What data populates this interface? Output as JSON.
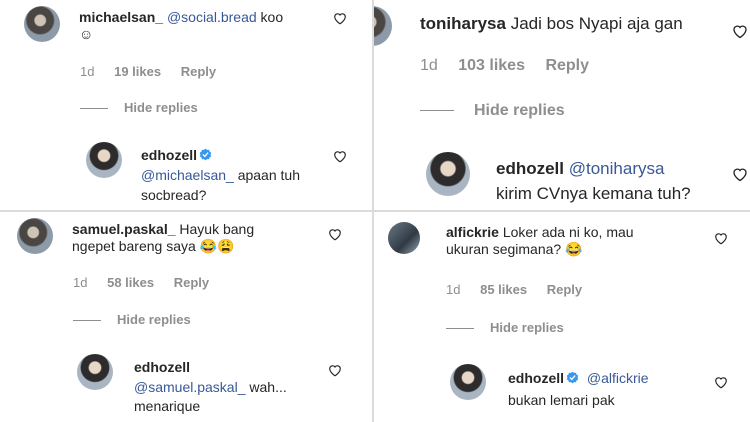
{
  "panels": [
    {
      "comment": {
        "username": "michaelsan_",
        "mention": "@social.bread",
        "text": "koo",
        "line2": "☺"
      },
      "meta": {
        "time": "1d",
        "likes": "19 likes",
        "reply": "Reply"
      },
      "hide_replies": "Hide replies",
      "reply": {
        "username": "edhozell",
        "mention": "@michaelsan_",
        "text": "apaan tuh",
        "line2": "socbread?"
      }
    },
    {
      "comment": {
        "username": "toniharysa",
        "mention": "",
        "text": "Jadi bos Nyapi aja gan",
        "line2": ""
      },
      "meta": {
        "time": "1d",
        "likes": "103 likes",
        "reply": "Reply"
      },
      "hide_replies": "Hide replies",
      "reply": {
        "username": "edhozell",
        "mention": "@toniharysa",
        "text": "",
        "line2": "kirim CVnya kemana tuh?"
      }
    },
    {
      "comment": {
        "username": "samuel.paskal_",
        "mention": "",
        "text": "Hayuk bang",
        "line2": "ngepet bareng saya 😂😩"
      },
      "meta": {
        "time": "1d",
        "likes": "58 likes",
        "reply": "Reply"
      },
      "hide_replies": "Hide replies",
      "reply": {
        "username": "edhozell",
        "mention": "@samuel.paskal_",
        "text": "wah...",
        "line2": "menarique"
      }
    },
    {
      "comment": {
        "username": "alfickrie",
        "mention": "",
        "text": "Loker ada ni ko, mau",
        "line2": "ukuran segimana? 😂"
      },
      "meta": {
        "time": "1d",
        "likes": "85 likes",
        "reply": "Reply"
      },
      "hide_replies": "Hide replies",
      "reply": {
        "username": "edhozell",
        "mention": "@alfickrie",
        "text": "",
        "line2": "bukan lemari pak"
      }
    }
  ],
  "colors": {
    "mention": "#385898",
    "meta": "#8e8e8e",
    "verified": "#3897f0"
  },
  "icons": {
    "like": "heart-outline-icon",
    "verified": "verified-badge-icon"
  }
}
